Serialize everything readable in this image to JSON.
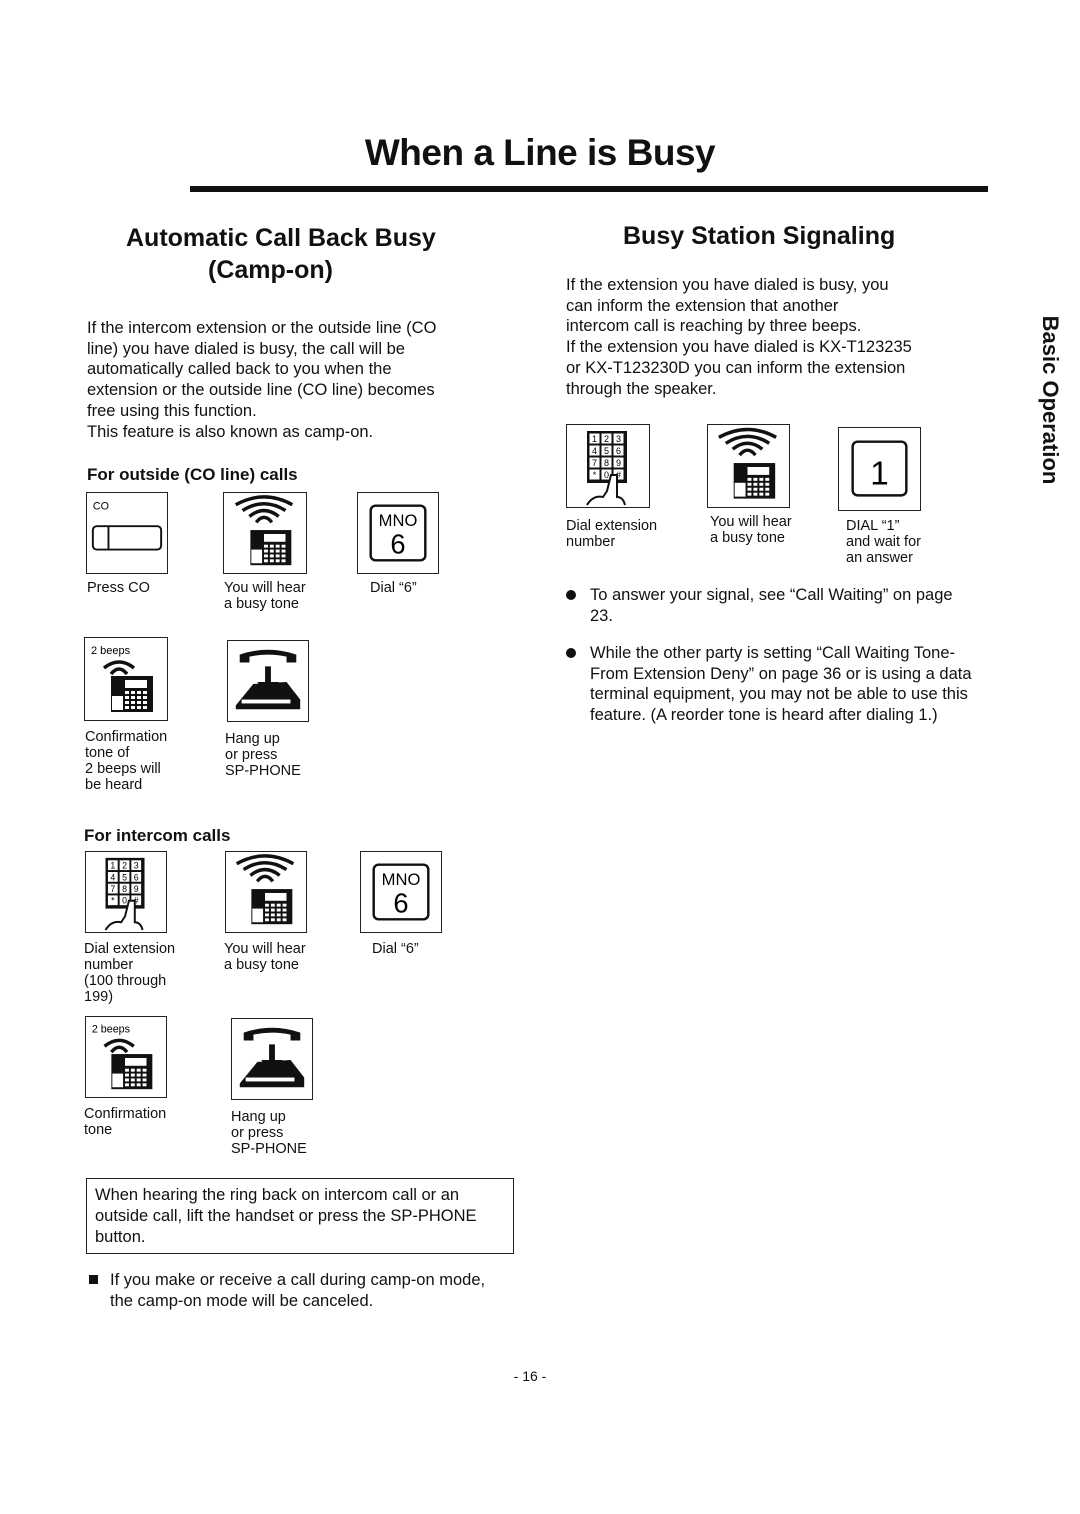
{
  "title": "When a Line is Busy",
  "side_tab": "Basic Operation",
  "left": {
    "heading_line1": "Automatic Call Back Busy",
    "heading_line2": "(Camp-on)",
    "paragraph": [
      "If the intercom extension or the outside line (CO",
      "line) you have dialed is busy, the call will be",
      "automatically called back to you when the",
      "extension or the outside line (CO line) becomes",
      "free using this function.",
      "This feature is also known as camp-on."
    ],
    "outside_heading": "For outside (CO line) calls",
    "outside_steps": [
      {
        "icon": "co-button-icon",
        "icon_text": "CO",
        "label": "Press CO"
      },
      {
        "icon": "busy-tone-phone-icon",
        "label": "You will hear\na busy tone"
      },
      {
        "icon": "dial-6-key-icon",
        "icon_text": "MNO",
        "icon_digit": "6",
        "label": "Dial “6”"
      },
      {
        "icon": "beeps-phone-icon",
        "icon_text": "2 beeps",
        "label": "Confirmation\ntone of\n2 beeps will\nbe heard"
      },
      {
        "icon": "hang-up-icon",
        "label": "Hang up\nor press\nSP-PHONE"
      }
    ],
    "intercom_heading": "For intercom calls",
    "intercom_steps": [
      {
        "icon": "keypad-icon",
        "label": "Dial extension\nnumber\n(100 through\n199)"
      },
      {
        "icon": "busy-tone-phone-icon",
        "label": "You will hear\na busy tone"
      },
      {
        "icon": "dial-6-key-icon",
        "icon_text": "MNO",
        "icon_digit": "6",
        "label": "Dial “6”"
      },
      {
        "icon": "beeps-phone-icon",
        "icon_text": "2 beeps",
        "label": "Confirmation\ntone"
      },
      {
        "icon": "hang-up-icon",
        "label": "Hang up\nor press\nSP-PHONE"
      }
    ],
    "note": "When hearing the ring back on intercom call or an outside call, lift the handset or press the SP-PHONE button.",
    "bullet": "If you make or receive a call during camp-on mode, the camp-on mode will be canceled."
  },
  "right": {
    "heading": "Busy Station Signaling",
    "paragraph": [
      "If the extension you have dialed is busy, you",
      "can inform the extension that another",
      "intercom call is reaching by three beeps.",
      "If the extension you have dialed is KX-T123235",
      "or KX-T123230D you can inform the extension",
      "through the speaker."
    ],
    "steps": [
      {
        "icon": "keypad-icon",
        "label": "Dial extension\nnumber"
      },
      {
        "icon": "busy-tone-phone-icon",
        "label": "You will hear\na busy tone"
      },
      {
        "icon": "dial-1-key-icon",
        "icon_digit": "1",
        "label": "DIAL “1”\nand wait for\nan answer"
      }
    ],
    "bullets": [
      "To answer your signal, see “Call Waiting” on page 23.",
      "While the other party is setting “Call Waiting Tone-From Extension Deny” on page 36 or is using a data terminal equipment, you may not be able to use this feature. (A reorder tone is heard after dialing 1.)"
    ]
  },
  "keypad_keys": [
    "1",
    "2",
    "3",
    "4",
    "5",
    "6",
    "7",
    "8",
    "9",
    "*",
    "0",
    "#"
  ],
  "page_number": "- 16 -"
}
